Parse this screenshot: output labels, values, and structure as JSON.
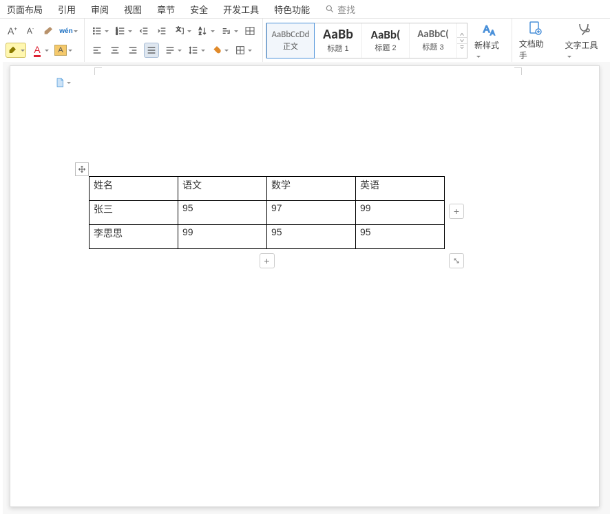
{
  "menu": {
    "items": [
      "页面布局",
      "引用",
      "审阅",
      "视图",
      "章节",
      "安全",
      "开发工具",
      "特色功能"
    ],
    "search": "查找"
  },
  "styleGallery": [
    {
      "sample": "AaBbCcDd",
      "label": "正文"
    },
    {
      "sample": "AaBb",
      "label": "标题 1"
    },
    {
      "sample": "AaBb(",
      "label": "标题 2"
    },
    {
      "sample": "AaBbC(",
      "label": "标题 3"
    }
  ],
  "big": {
    "newstyle": "新样式",
    "dochelper": "文档助手",
    "texttool": "文字工具"
  },
  "table": {
    "headers": [
      "姓名",
      "语文",
      "数学",
      "英语"
    ],
    "rows": [
      [
        "张三",
        "95",
        "97",
        "99"
      ],
      [
        "李思思",
        "99",
        "95",
        "95"
      ]
    ]
  }
}
